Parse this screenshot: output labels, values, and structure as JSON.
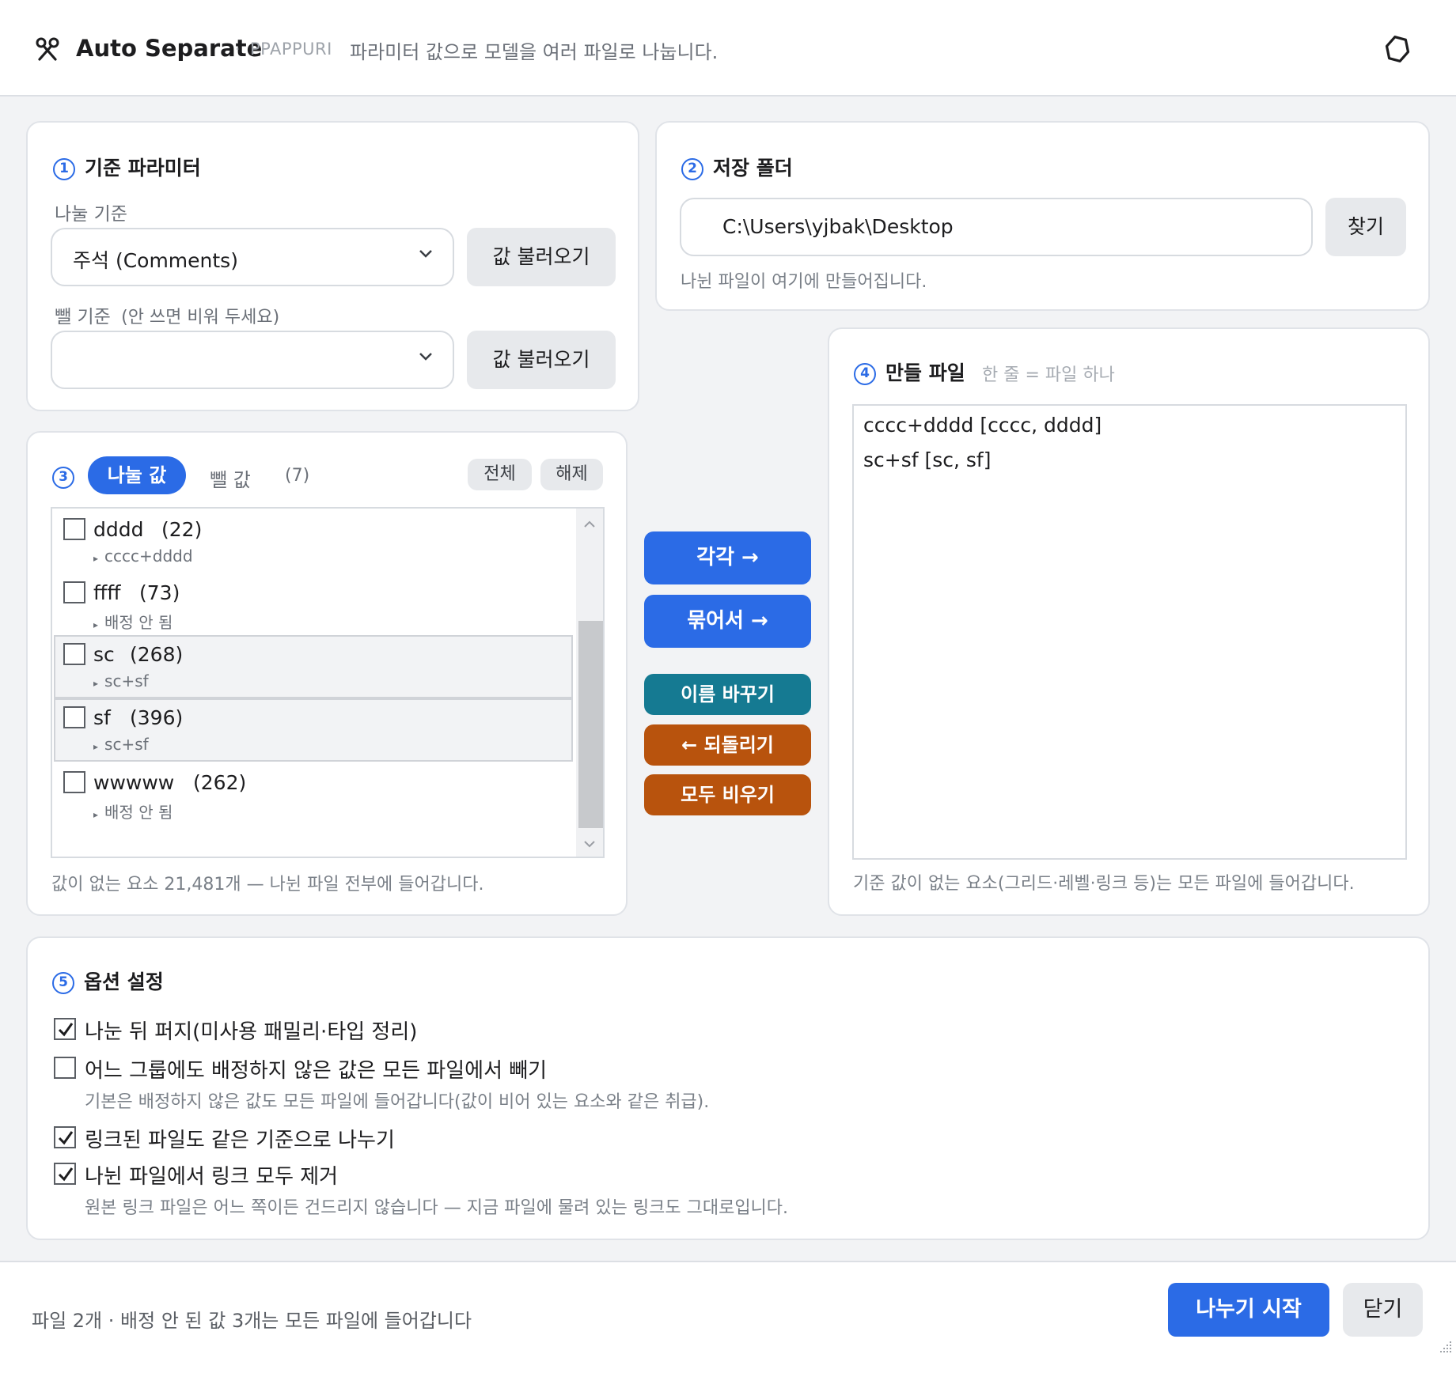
{
  "header": {
    "title": "Auto Separate",
    "separator": "·",
    "brand": "PPAPPURI",
    "description": "파라미터 값으로 모델을 여러 파일로 나눕니다."
  },
  "section1": {
    "number": "1",
    "title": "기준 파라미터",
    "split_label": "나눌 기준",
    "split_value": "주석 (Comments)",
    "load_button": "값 불러오기",
    "exclude_label": "뺄 기준",
    "exclude_hint": "(안 쓰면 비워 두세요)",
    "exclude_value": "",
    "load_button2": "값 불러오기"
  },
  "section2": {
    "number": "2",
    "title": "저장 폴더",
    "path": "C:\\Users\\yjbak\\Desktop",
    "browse_button": "찾기",
    "hint": "나뉜 파일이 여기에 만들어집니다."
  },
  "section3": {
    "number": "3",
    "tab_active": "나눌 값",
    "tab_inactive": "뺄 값",
    "count": "(7)",
    "select_all": "전체",
    "deselect": "해제",
    "items": [
      {
        "name": "dddd",
        "count": "(22)",
        "sub": "cccc+dddd",
        "checked": false
      },
      {
        "name": "ffff",
        "count": "(73)",
        "sub": "배정 안 됨",
        "checked": false
      },
      {
        "name": "sc",
        "count": "(268)",
        "sub": "sc+sf",
        "checked": false
      },
      {
        "name": "sf",
        "count": "(396)",
        "sub": "sc+sf",
        "checked": false
      },
      {
        "name": "wwwww",
        "count": "(262)",
        "sub": "배정 안 됨",
        "checked": false
      }
    ],
    "footnote": "값이 없는 요소 21,481개 — 나뉜 파일 전부에 들어갑니다."
  },
  "middle": {
    "each": "각각 →",
    "group": "묶어서 →",
    "rename": "이름 바꾸기",
    "undo": "← 되돌리기",
    "clear_all": "모두 비우기"
  },
  "section4": {
    "number": "4",
    "title": "만들 파일",
    "subtitle": "한 줄 = 파일 하나",
    "lines": [
      "cccc+dddd  [cccc, dddd]",
      "sc+sf  [sc, sf]"
    ],
    "footnote": "기준 값이 없는 요소(그리드·레벨·링크 등)는 모든 파일에 들어갑니다."
  },
  "section5": {
    "number": "5",
    "title": "옵션 설정",
    "options": [
      {
        "label": "나눈 뒤 퍼지(미사용 패밀리·타입 정리)",
        "checked": true
      },
      {
        "label": "어느 그룹에도 배정하지 않은 값은 모든 파일에서 빼기",
        "checked": false,
        "hint": "기본은 배정하지 않은 값도 모든 파일에 들어갑니다(값이 비어 있는 요소와 같은 취급)."
      },
      {
        "label": "링크된 파일도 같은 기준으로 나누기",
        "checked": true
      },
      {
        "label": "나뉜 파일에서 링크 모두 제거",
        "checked": true,
        "hint": "원본 링크 파일은 어느 쪽이든 건드리지 않습니다 — 지금 파일에 물려 있는 링크도 그대로입니다."
      }
    ]
  },
  "footer": {
    "status": "파일 2개 · 배정 안 된 값 3개는 모든 파일에 들어갑니다",
    "start_button": "나누기 시작",
    "close_button": "닫기"
  },
  "colors": {
    "accent": "#2b6be6",
    "teal": "#157a92",
    "orange": "#b8530d"
  }
}
